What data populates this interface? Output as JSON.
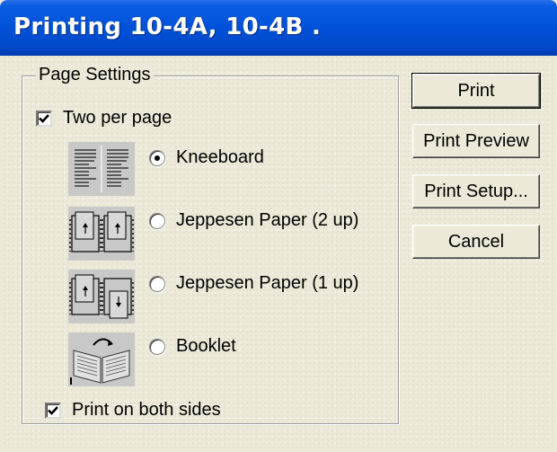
{
  "window": {
    "title": "Printing 10-4A, 10-4B ."
  },
  "page_settings": {
    "legend": "Page Settings",
    "two_per_page": {
      "label": "Two per page",
      "checked": true
    },
    "layouts": [
      {
        "label": "Kneeboard",
        "selected": true,
        "icon": "kneeboard-layout-icon"
      },
      {
        "label": "Jeppesen Paper (2 up)",
        "selected": false,
        "icon": "jeppesen-2up-layout-icon"
      },
      {
        "label": "Jeppesen Paper (1 up)",
        "selected": false,
        "icon": "jeppesen-1up-layout-icon"
      },
      {
        "label": "Booklet",
        "selected": false,
        "icon": "booklet-layout-icon"
      }
    ],
    "print_both_sides": {
      "label": "Print on both sides",
      "checked": true
    }
  },
  "buttons": {
    "print": "Print",
    "print_preview": "Print Preview",
    "print_setup": "Print Setup...",
    "cancel": "Cancel"
  },
  "colors": {
    "titlebar": "#0051d8",
    "face": "#ece9d8",
    "thumb_bg": "#c8c8c8"
  }
}
